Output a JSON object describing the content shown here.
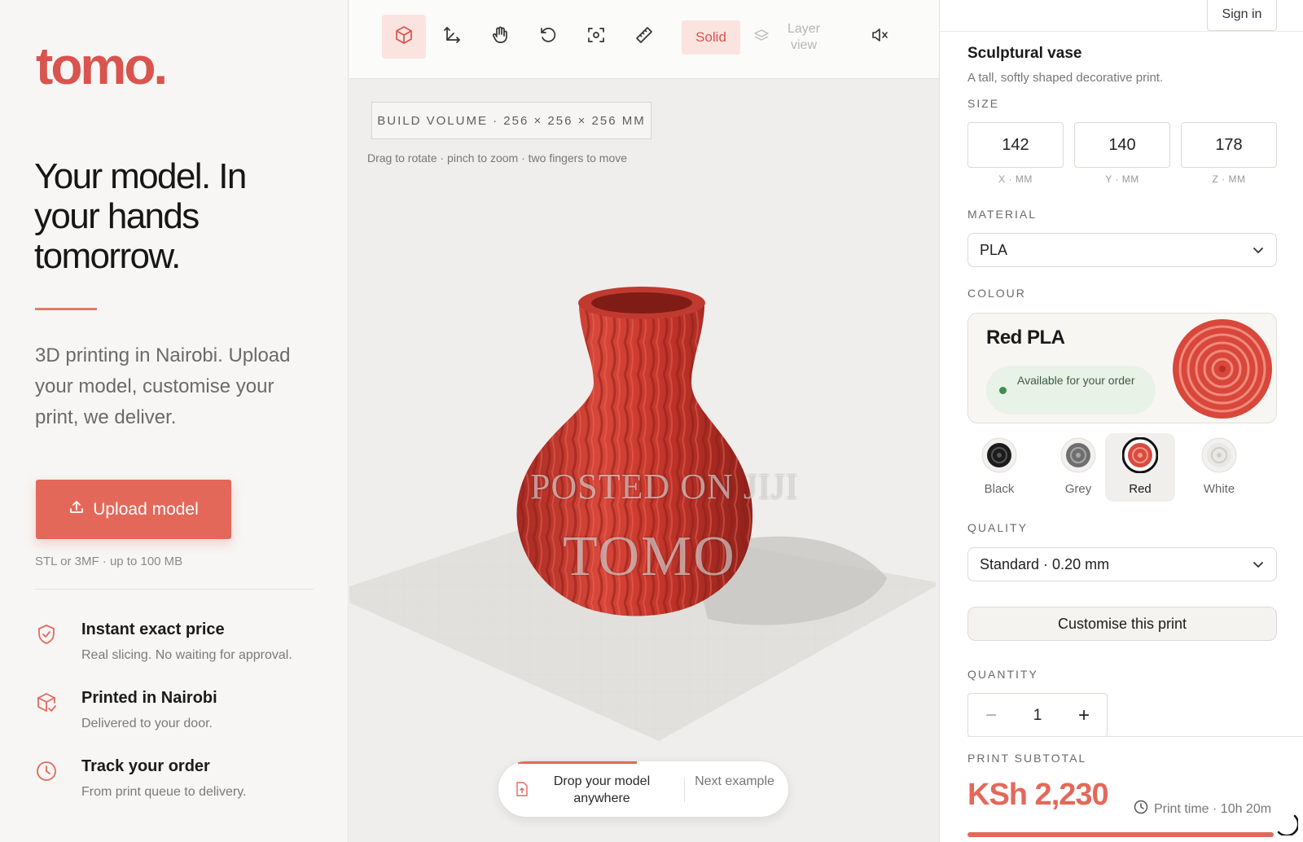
{
  "brand": {
    "logo": "tomo."
  },
  "left": {
    "hero": "Your model. In your hands tomorrow.",
    "lede": "3D printing in Nairobi. Upload your model, customise your print, we deliver.",
    "upload_label": "Upload model",
    "upload_hint": "STL or 3MF · up to 100 MB",
    "features": [
      {
        "title": "Instant exact price",
        "desc": "Real slicing. No waiting for approval.",
        "icon": "shield-check-icon"
      },
      {
        "title": "Printed in Nairobi",
        "desc": "Delivered to your door.",
        "icon": "package-check-icon"
      },
      {
        "title": "Track your order",
        "desc": "From print queue to delivery.",
        "icon": "clock-icon"
      }
    ]
  },
  "toolbar": {
    "solid_label": "Solid",
    "layer_view_label": "Layer view",
    "tools": [
      "cube-icon",
      "axes-icon",
      "hand-icon",
      "rotate-icon",
      "focus-icon",
      "ruler-icon"
    ]
  },
  "viewer": {
    "build_volume": "BUILD VOLUME · 256 × 256 × 256 MM",
    "drag_hint": "Drag to rotate · pinch to zoom · two fingers to move",
    "watermark_line1": "POSTED ON JIJI",
    "watermark_line2": "TOMO",
    "drop_label": "Drop your model anywhere",
    "next_example": "Next example"
  },
  "right": {
    "sign_in": "Sign in",
    "product_title": "Sculptural vase",
    "product_sub": "A tall, softly shaped decorative print.",
    "size_label": "SIZE",
    "size": [
      {
        "value": "142",
        "caption": "X · MM"
      },
      {
        "value": "140",
        "caption": "Y · MM"
      },
      {
        "value": "178",
        "caption": "Z · MM"
      }
    ],
    "material_label": "MATERIAL",
    "material_value": "PLA",
    "colour_label": "COLOUR",
    "colour_card_title": "Red PLA",
    "availability": "Available for your order",
    "swatches": [
      {
        "label": "Black",
        "color": "#1c1c1c",
        "selected": false
      },
      {
        "label": "Grey",
        "color": "#6f6f6f",
        "selected": false
      },
      {
        "label": "Red",
        "color": "#d94a3f",
        "selected": true
      },
      {
        "label": "White",
        "color": "#e9e8e4",
        "selected": false
      }
    ],
    "quality_label": "QUALITY",
    "quality_value": "Standard · 0.20 mm",
    "customise_label": "Customise this print",
    "quantity_label": "QUANTITY",
    "quantity_value": "1",
    "minus": "−",
    "plus": "+",
    "subtotal_label": "PRINT SUBTOTAL",
    "subtotal_value": "KSh 2,230",
    "print_time": "Print time · 10h 20m"
  },
  "colors": {
    "accent": "#e4685a",
    "brand": "#d9534f",
    "vase": "#c7372c"
  }
}
